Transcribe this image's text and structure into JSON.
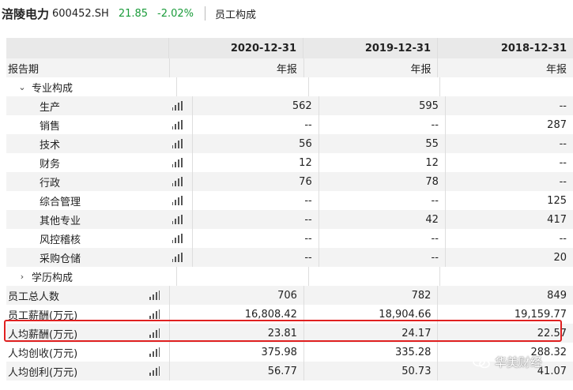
{
  "header": {
    "company": "涪陵电力",
    "code": "600452.SH",
    "price": "21.85",
    "change": "-2.02%",
    "page": "员工构成"
  },
  "colors": {
    "down": "#1a9b3a",
    "highlight": "#e02020"
  },
  "table": {
    "columns": [
      "2020-12-31",
      "2019-12-31",
      "2018-12-31"
    ],
    "rows": [
      {
        "label": "报告期",
        "level": 0,
        "values": [
          "年报",
          "年报",
          "年报"
        ]
      },
      {
        "label": "专业构成",
        "level": 1,
        "chevron": "⌄",
        "values": [
          "",
          "",
          ""
        ]
      },
      {
        "label": "生产",
        "level": 2,
        "values": [
          "562",
          "595",
          "--"
        ]
      },
      {
        "label": "销售",
        "level": 2,
        "values": [
          "--",
          "--",
          "287"
        ]
      },
      {
        "label": "技术",
        "level": 2,
        "values": [
          "56",
          "55",
          "--"
        ]
      },
      {
        "label": "财务",
        "level": 2,
        "values": [
          "12",
          "12",
          "--"
        ]
      },
      {
        "label": "行政",
        "level": 2,
        "values": [
          "76",
          "78",
          "--"
        ]
      },
      {
        "label": "综合管理",
        "level": 2,
        "values": [
          "--",
          "--",
          "125"
        ]
      },
      {
        "label": "其他专业",
        "level": 2,
        "values": [
          "--",
          "42",
          "417"
        ]
      },
      {
        "label": "风控稽核",
        "level": 2,
        "values": [
          "--",
          "--",
          "--"
        ]
      },
      {
        "label": "采购仓储",
        "level": 2,
        "values": [
          "--",
          "--",
          "20"
        ]
      },
      {
        "label": "学历构成",
        "level": 1,
        "chevron": "›",
        "values": [
          "",
          "",
          ""
        ]
      },
      {
        "label": "员工总人数",
        "level": 0,
        "values": [
          "706",
          "782",
          "849"
        ]
      },
      {
        "label": "员工薪酬(万元)",
        "level": 0,
        "values": [
          "16,808.42",
          "18,904.66",
          "19,159.77"
        ]
      },
      {
        "label": "人均薪酬(万元)",
        "level": 0,
        "values": [
          "23.81",
          "24.17",
          "22.57"
        ]
      },
      {
        "label": "人均创收(万元)",
        "level": 0,
        "values": [
          "375.98",
          "335.28",
          "288.32"
        ]
      },
      {
        "label": "人均创利(万元)",
        "level": 0,
        "values": [
          "56.77",
          "50.73",
          "41.07"
        ]
      }
    ]
  },
  "watermark": {
    "text": "华美财经",
    "icon": "wechat-icon"
  }
}
